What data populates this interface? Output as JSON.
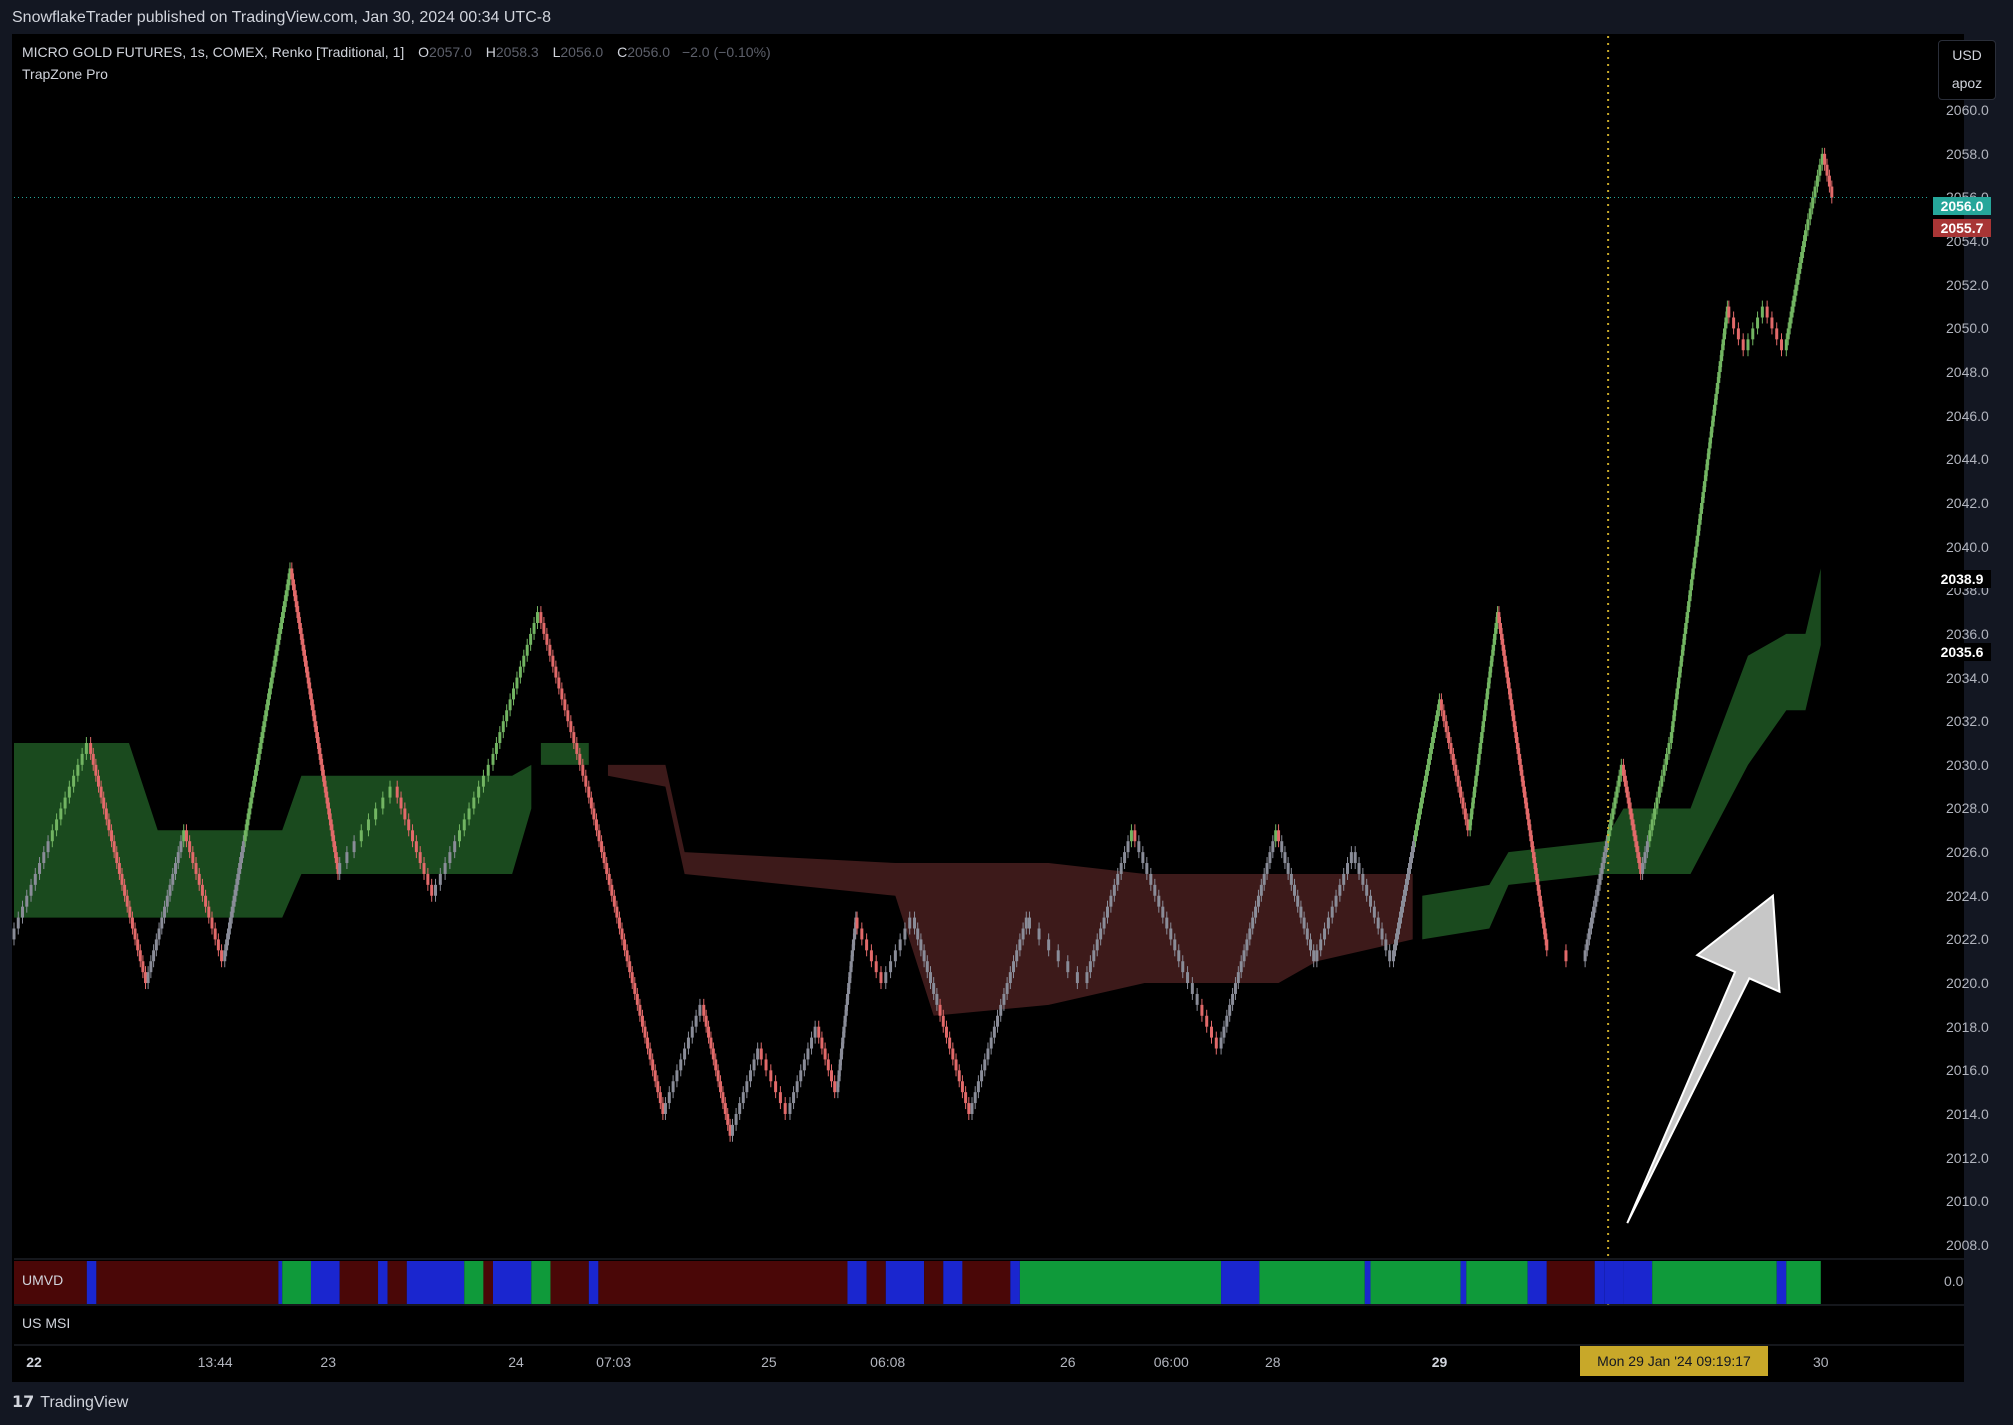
{
  "header": {
    "publication": "SnowflakeTrader published on TradingView.com, Jan 30, 2024 00:34 UTC-8"
  },
  "legend": {
    "symbol": "MICRO GOLD FUTURES, 1s, COMEX, Renko [Traditional, 1]",
    "open_key": "O",
    "open": "2057.0",
    "high_key": "H",
    "high": "2058.3",
    "low_key": "L",
    "low": "2056.0",
    "close_key": "C",
    "close": "2056.0",
    "change": "−2.0 (−0.10%)",
    "indicator": "TrapZone Pro"
  },
  "currency": {
    "unit": "USD",
    "account": "apoz"
  },
  "price_tags": {
    "last": "2056.0",
    "indicator_value": "2055.7",
    "upper_value": "2038.9",
    "lower_value": "2035.6",
    "last_color": "#26a69a",
    "indicator_color": "#a83535"
  },
  "indicators": {
    "umvd_label": "UMVD",
    "umvd_value": "0.0",
    "msi_label": "US MSI"
  },
  "crosshair": {
    "time": "Mon 29 Jan '24   09:19:17"
  },
  "footer": {
    "brand": "TradingView",
    "logo": "tradingview-logo-icon"
  },
  "colors": {
    "bull_candle": "#72b562",
    "bear_candle": "#e26a6a",
    "neutral_candle": "#8a8d99",
    "green_zone": "#1a4a1e",
    "red_zone": "#3d1a1a",
    "umvd_green": "#0f9a3a",
    "umvd_red": "#4a0707",
    "umvd_blue": "#1a26cf",
    "crosshair": "#c8a829"
  },
  "chart_data": {
    "type": "renko",
    "y_ticks": [
      2008.0,
      2010.0,
      2012.0,
      2014.0,
      2016.0,
      2018.0,
      2020.0,
      2022.0,
      2024.0,
      2026.0,
      2028.0,
      2030.0,
      2032.0,
      2034.0,
      2036.0,
      2038.0,
      2040.0,
      2042.0,
      2044.0,
      2046.0,
      2048.0,
      2050.0,
      2052.0,
      2054.0,
      2056.0,
      2058.0,
      2060.0
    ],
    "ylim": [
      2007.4,
      2063.4
    ],
    "x_ticks": [
      {
        "label": "22",
        "bold": true,
        "pos": 0.01
      },
      {
        "label": "13:44",
        "bold": false,
        "pos": 0.105
      },
      {
        "label": "23",
        "bold": false,
        "pos": 0.164
      },
      {
        "label": "24",
        "bold": false,
        "pos": 0.262
      },
      {
        "label": "07:03",
        "bold": false,
        "pos": 0.313
      },
      {
        "label": "25",
        "bold": false,
        "pos": 0.394
      },
      {
        "label": "06:08",
        "bold": false,
        "pos": 0.456
      },
      {
        "label": "26",
        "bold": false,
        "pos": 0.55
      },
      {
        "label": "06:00",
        "bold": false,
        "pos": 0.604
      },
      {
        "label": "28",
        "bold": false,
        "pos": 0.657
      },
      {
        "label": "29",
        "bold": true,
        "pos": 0.744
      },
      {
        "label": "30",
        "bold": false,
        "pos": 0.943
      }
    ],
    "price_path": [
      [
        0.0,
        2022.0
      ],
      [
        0.04,
        2031.0
      ],
      [
        0.07,
        2020.0
      ],
      [
        0.09,
        2027.0
      ],
      [
        0.11,
        2021.0
      ],
      [
        0.145,
        2039.0
      ],
      [
        0.17,
        2025.0
      ],
      [
        0.2,
        2029.0
      ],
      [
        0.22,
        2024.0
      ],
      [
        0.25,
        2030.0
      ],
      [
        0.275,
        2037.0
      ],
      [
        0.3,
        2029.0
      ],
      [
        0.34,
        2014.0
      ],
      [
        0.36,
        2019.0
      ],
      [
        0.375,
        2013.0
      ],
      [
        0.39,
        2017.0
      ],
      [
        0.405,
        2014.0
      ],
      [
        0.42,
        2018.0
      ],
      [
        0.43,
        2015.0
      ],
      [
        0.44,
        2023.0
      ],
      [
        0.455,
        2020.0
      ],
      [
        0.47,
        2023.0
      ],
      [
        0.5,
        2014.0
      ],
      [
        0.53,
        2023.0
      ],
      [
        0.56,
        2020.0
      ],
      [
        0.585,
        2027.0
      ],
      [
        0.61,
        2021.0
      ],
      [
        0.63,
        2017.0
      ],
      [
        0.66,
        2027.0
      ],
      [
        0.68,
        2021.0
      ],
      [
        0.7,
        2026.0
      ],
      [
        0.72,
        2021.0
      ],
      [
        0.745,
        2033.0
      ],
      [
        0.76,
        2027.0
      ],
      [
        0.775,
        2037.0
      ],
      [
        0.8,
        2022.0
      ],
      [
        0.82,
        2021.0
      ],
      [
        0.84,
        2030.0
      ],
      [
        0.85,
        2025.0
      ],
      [
        0.865,
        2031.0
      ],
      [
        0.88,
        2041.0
      ],
      [
        0.895,
        2051.0
      ],
      [
        0.905,
        2049.0
      ],
      [
        0.915,
        2051.0
      ],
      [
        0.925,
        2049.0
      ],
      [
        0.935,
        2054.0
      ],
      [
        0.945,
        2058.0
      ],
      [
        0.95,
        2056.0
      ]
    ],
    "green_zone": [
      {
        "x": 0.0,
        "top": 2031.0,
        "bottom": 2023.0
      },
      {
        "x": 0.06,
        "top": 2031.0,
        "bottom": 2023.0
      },
      {
        "x": 0.075,
        "top": 2027.0,
        "bottom": 2023.0
      },
      {
        "x": 0.14,
        "top": 2027.0,
        "bottom": 2023.0
      },
      {
        "x": 0.15,
        "top": 2029.5,
        "bottom": 2025.0
      },
      {
        "x": 0.26,
        "top": 2029.5,
        "bottom": 2025.0
      },
      {
        "x": 0.27,
        "top": 2030.0,
        "bottom": 2028.0
      }
    ],
    "green_zone_2": [
      {
        "x": 0.275,
        "top": 2031.0,
        "bottom": 2030.0
      },
      {
        "x": 0.3,
        "top": 2031.0,
        "bottom": 2030.0
      }
    ],
    "red_zone": [
      {
        "x": 0.31,
        "top": 2030.0,
        "bottom": 2029.5
      },
      {
        "x": 0.34,
        "top": 2030.0,
        "bottom": 2029.0
      },
      {
        "x": 0.35,
        "top": 2026.0,
        "bottom": 2025.0
      },
      {
        "x": 0.46,
        "top": 2025.5,
        "bottom": 2024.0
      },
      {
        "x": 0.48,
        "top": 2025.5,
        "bottom": 2018.5
      },
      {
        "x": 0.54,
        "top": 2025.5,
        "bottom": 2019.0
      },
      {
        "x": 0.59,
        "top": 2025.0,
        "bottom": 2020.0
      },
      {
        "x": 0.66,
        "top": 2025.0,
        "bottom": 2020.0
      },
      {
        "x": 0.68,
        "top": 2025.0,
        "bottom": 2021.0
      },
      {
        "x": 0.73,
        "top": 2025.0,
        "bottom": 2022.0
      }
    ],
    "green_zone_3": [
      {
        "x": 0.735,
        "top": 2024.0,
        "bottom": 2022.0
      },
      {
        "x": 0.77,
        "top": 2024.5,
        "bottom": 2022.5
      },
      {
        "x": 0.78,
        "top": 2026.0,
        "bottom": 2024.5
      },
      {
        "x": 0.83,
        "top": 2026.5,
        "bottom": 2025.0
      },
      {
        "x": 0.84,
        "top": 2028.0,
        "bottom": 2025.0
      },
      {
        "x": 0.875,
        "top": 2028.0,
        "bottom": 2025.0
      },
      {
        "x": 0.905,
        "top": 2035.0,
        "bottom": 2030.0
      },
      {
        "x": 0.925,
        "top": 2036.0,
        "bottom": 2032.5
      },
      {
        "x": 0.935,
        "top": 2036.0,
        "bottom": 2032.5
      },
      {
        "x": 0.943,
        "top": 2039.0,
        "bottom": 2035.5
      }
    ],
    "umvd_segments": [
      [
        0.0,
        0.038,
        "red"
      ],
      [
        0.038,
        0.043,
        "blue"
      ],
      [
        0.043,
        0.138,
        "red"
      ],
      [
        0.138,
        0.14,
        "blue"
      ],
      [
        0.14,
        0.155,
        "green"
      ],
      [
        0.155,
        0.17,
        "blue"
      ],
      [
        0.17,
        0.19,
        "red"
      ],
      [
        0.19,
        0.195,
        "blue"
      ],
      [
        0.195,
        0.205,
        "red"
      ],
      [
        0.205,
        0.235,
        "blue"
      ],
      [
        0.235,
        0.245,
        "green"
      ],
      [
        0.245,
        0.25,
        "red"
      ],
      [
        0.25,
        0.27,
        "blue"
      ],
      [
        0.27,
        0.28,
        "green"
      ],
      [
        0.28,
        0.3,
        "red"
      ],
      [
        0.3,
        0.305,
        "blue"
      ],
      [
        0.305,
        0.435,
        "red"
      ],
      [
        0.435,
        0.445,
        "blue"
      ],
      [
        0.445,
        0.455,
        "red"
      ],
      [
        0.455,
        0.475,
        "blue"
      ],
      [
        0.475,
        0.485,
        "red"
      ],
      [
        0.485,
        0.495,
        "blue"
      ],
      [
        0.495,
        0.52,
        "red"
      ],
      [
        0.52,
        0.525,
        "blue"
      ],
      [
        0.525,
        0.63,
        "green"
      ],
      [
        0.63,
        0.65,
        "blue"
      ],
      [
        0.65,
        0.705,
        "green"
      ],
      [
        0.705,
        0.708,
        "blue"
      ],
      [
        0.708,
        0.755,
        "green"
      ],
      [
        0.755,
        0.758,
        "blue"
      ],
      [
        0.758,
        0.79,
        "green"
      ],
      [
        0.79,
        0.8,
        "blue"
      ],
      [
        0.8,
        0.825,
        "red"
      ],
      [
        0.825,
        0.83,
        "blue"
      ],
      [
        0.83,
        0.84,
        "blue"
      ],
      [
        0.84,
        0.855,
        "blue"
      ],
      [
        0.855,
        0.92,
        "green"
      ],
      [
        0.92,
        0.925,
        "blue"
      ],
      [
        0.925,
        0.943,
        "green"
      ]
    ],
    "crosshair_x": 0.832,
    "last_price": 2056.0,
    "arrow": {
      "from": [
        0.842,
        2009.0
      ],
      "to": [
        0.918,
        2024.0
      ]
    }
  }
}
